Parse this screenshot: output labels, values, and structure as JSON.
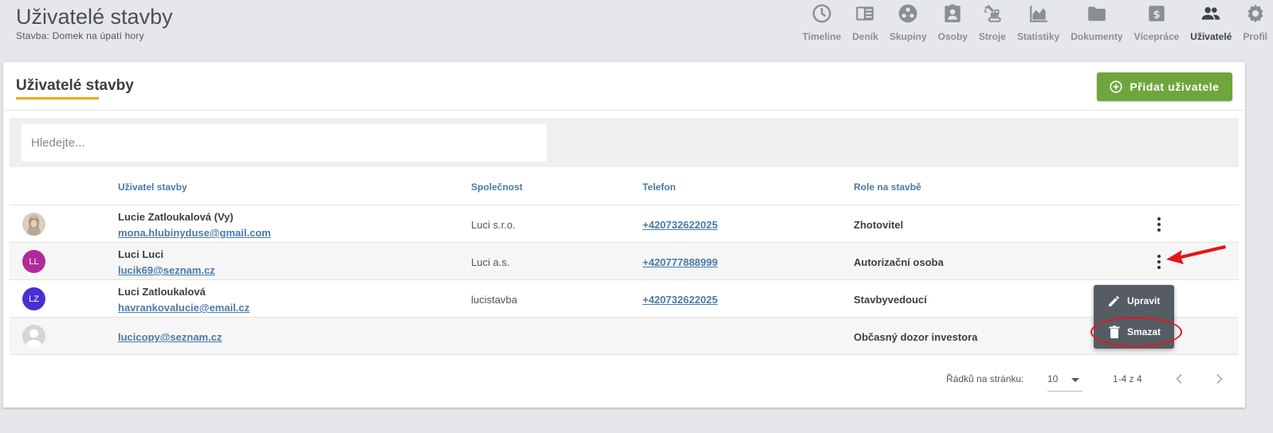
{
  "header": {
    "title": "Uživatelé stavby",
    "subtitle": "Stavba: Domek na úpatí hory"
  },
  "nav": [
    {
      "label": "Timeline",
      "icon": "clock-icon",
      "active": false
    },
    {
      "label": "Deník",
      "icon": "journal-icon",
      "active": false
    },
    {
      "label": "Skupiny",
      "icon": "groups-icon",
      "active": false
    },
    {
      "label": "Osoby",
      "icon": "person-badge-icon",
      "active": false
    },
    {
      "label": "Stroje",
      "icon": "excavator-icon",
      "active": false
    },
    {
      "label": "Statistiky",
      "icon": "area-chart-icon",
      "active": false
    },
    {
      "label": "Dokumenty",
      "icon": "folder-icon",
      "active": false
    },
    {
      "label": "Vícepráce",
      "icon": "dollar-doc-icon",
      "active": false
    },
    {
      "label": "Uživatelé",
      "icon": "users-icon",
      "active": true
    },
    {
      "label": "Profil",
      "icon": "gear-icon",
      "active": false
    }
  ],
  "card": {
    "title": "Uživatelé stavby",
    "add_button": "Přidat uživatele"
  },
  "search": {
    "placeholder": "Hledejte..."
  },
  "table": {
    "columns": [
      "Uživatel stavby",
      "Společnost",
      "Telefon",
      "Role na stavbě"
    ],
    "rows": [
      {
        "name": "Lucie Zatloukalová (Vy)",
        "email": "mona.hlubinyduse@gmail.com",
        "company": "Luci s.r.o.",
        "phone": "+420732622025",
        "role": "Zhotovitel",
        "avatar": "photo",
        "initials": ""
      },
      {
        "name": "Luci Luci",
        "email": "lucik69@seznam.cz",
        "company": "Luci a.s.",
        "phone": "+420777888999",
        "role": "Autorizační osoba",
        "avatar": "initials",
        "initials": "LL"
      },
      {
        "name": "Luci Zatloukalová",
        "email": "havrankovalucie@email.cz",
        "company": "lucistavba",
        "phone": "+420732622025",
        "role": "Stavbyvedoucí",
        "avatar": "initials",
        "initials": "LZ"
      },
      {
        "name": "",
        "email": "lucicopy@seznam.cz",
        "company": "",
        "phone": "",
        "role": "Občasný dozor investora",
        "avatar": "placeholder",
        "initials": ""
      }
    ]
  },
  "pagination": {
    "rows_per_page_label": "Řádků na stránku:",
    "rows_per_page": "10",
    "range": "1-4 z 4"
  },
  "context_menu": {
    "edit": "Upravit",
    "delete": "Smazat"
  },
  "colors": {
    "accent_green": "#6ea63d",
    "link_blue": "#4a7aa7",
    "tab_underline": "#f2a511",
    "avatar_ll": "#b02a9a",
    "avatar_lz": "#4a2fd0",
    "annotation_red": "#e8141a"
  }
}
